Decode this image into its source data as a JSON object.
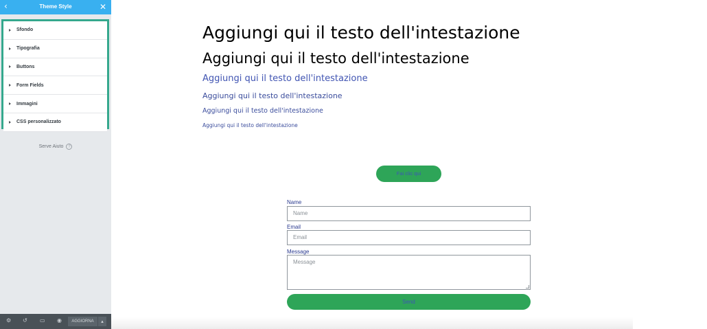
{
  "panel": {
    "title": "Theme Style",
    "back_icon": "chevron-left-icon",
    "close_icon": "close-icon",
    "sections": [
      {
        "label": "Sfondo"
      },
      {
        "label": "Tipografia"
      },
      {
        "label": "Buttons"
      },
      {
        "label": "Form Fields"
      },
      {
        "label": "Immagini"
      },
      {
        "label": "CSS personalizzato"
      }
    ],
    "help_text": "Serve Aiuto",
    "help_icon_glyph": "?",
    "footer": {
      "update_label": "AGGIORNA",
      "icons": [
        "gear-icon",
        "history-icon",
        "responsive-icon",
        "eye-icon",
        "caret-up-icon"
      ]
    },
    "colors": {
      "header": "#39b0f0",
      "highlight": "#35a88d",
      "footer": "#495157"
    }
  },
  "preview": {
    "headings": [
      "Aggiungi qui il testo dell'intestazione",
      "Aggiungi qui il testo dell'intestazione",
      "Aggiungi qui il testo dell'intestazione",
      "Aggiungi qui il testo dell'intestazione",
      "Aggiungi qui il testo dell'intestazione",
      "Aggiungi qui il testo dell'intestazione"
    ],
    "button_label": "Fai clic qui",
    "form": {
      "name_label": "Name",
      "name_placeholder": "Name",
      "email_label": "Email",
      "email_placeholder": "Email",
      "message_label": "Message",
      "message_placeholder": "Message",
      "submit_label": "Send"
    },
    "colors": {
      "button": "#2ea558",
      "accent_text": "#4054b2"
    }
  }
}
